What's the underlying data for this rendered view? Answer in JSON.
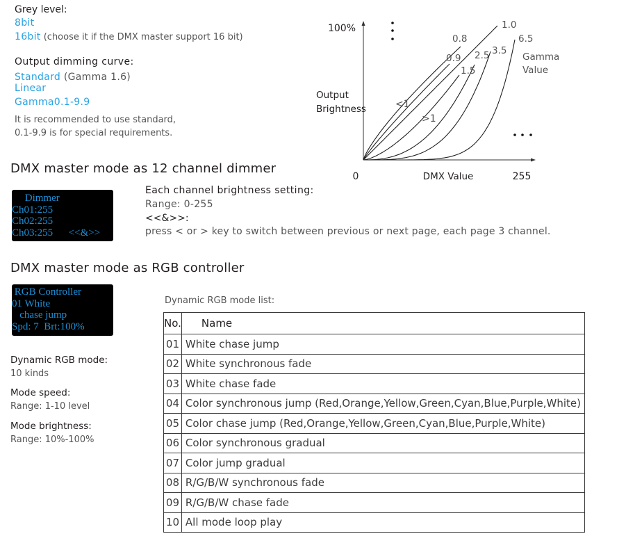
{
  "grey_level": {
    "label": "Grey level:",
    "opt_8bit": "8bit",
    "opt_16bit": "16bit",
    "opt_16bit_note": " (choose it if the DMX master support 16 bit)"
  },
  "dimming_curve": {
    "label": "Output dimming curve:",
    "standard": "Standard",
    "standard_note": " (Gamma 1.6)",
    "linear": "Linear",
    "gamma": "Gamma0.1-9.9",
    "note_line1": "It is recommended to use standard,",
    "note_line2": "0.1-9.9 is for special requirements."
  },
  "chart_data": {
    "type": "line",
    "title": "",
    "xlabel": "DMX Value",
    "ylabel": "Output Brightness",
    "x_ticks": [
      "0",
      "255"
    ],
    "y_ticks": [
      "100%"
    ],
    "xlim": [
      0,
      255
    ],
    "ylim": [
      0,
      100
    ],
    "legend_title": "Gamma Value",
    "series": [
      {
        "name": "0.8",
        "gamma": 0.8
      },
      {
        "name": "0.9",
        "gamma": 0.9
      },
      {
        "name": "1.0",
        "gamma": 1.0
      },
      {
        "name": "1.5",
        "gamma": 1.5
      },
      {
        "name": "2.5",
        "gamma": 2.5
      },
      {
        "name": "3.5",
        "gamma": 3.5
      },
      {
        "name": "6.5",
        "gamma": 6.5
      }
    ],
    "annotations": [
      "<1",
      ">1",
      "⋮",
      "…"
    ]
  },
  "dimmer_section": {
    "heading": "DMX master mode as 12 channel dimmer",
    "lcd_lines": [
      "     Dimmer",
      "Ch01:255",
      "Ch02:255",
      "Ch03:255      <<&>>"
    ],
    "desc_title": "Each channel brightness setting:",
    "range": "Range: 0-255",
    "keys_label": "<<&>>:",
    "keys_desc": "press < or > key to switch between previous or next page, each page 3 channel."
  },
  "rgb_section": {
    "heading": "DMX master mode as RGB controller",
    "lcd_lines": [
      " RGB Controller",
      "01 White",
      "   chase jump",
      "Spd: 7  Brt:100%"
    ],
    "dynamic_mode_label": "Dynamic RGB mode:",
    "dynamic_mode_value": "10 kinds",
    "speed_label": "Mode speed:",
    "speed_value": "Range:  1-10 level",
    "brightness_label": "Mode brightness:",
    "brightness_value": "Range:  10%-100%",
    "table_caption": "Dynamic RGB mode list:",
    "table_headers": [
      "No.",
      "Name"
    ],
    "table_rows": [
      {
        "no": "01",
        "name": "White chase jump"
      },
      {
        "no": "02",
        "name": "White synchronous fade"
      },
      {
        "no": "03",
        "name": "White chase fade"
      },
      {
        "no": "04",
        "name": "Color synchronous jump (Red,Orange,Yellow,Green,Cyan,Blue,Purple,White)"
      },
      {
        "no": "05",
        "name": "Color chase jump (Red,Orange,Yellow,Green,Cyan,Blue,Purple,White)"
      },
      {
        "no": "06",
        "name": "Color synchronous gradual"
      },
      {
        "no": "07",
        "name": "Color jump gradual"
      },
      {
        "no": "08",
        "name": "R/G/B/W synchronous fade"
      },
      {
        "no": "09",
        "name": "R/G/B/W chase fade"
      },
      {
        "no": "10",
        "name": "All mode loop play"
      }
    ]
  }
}
